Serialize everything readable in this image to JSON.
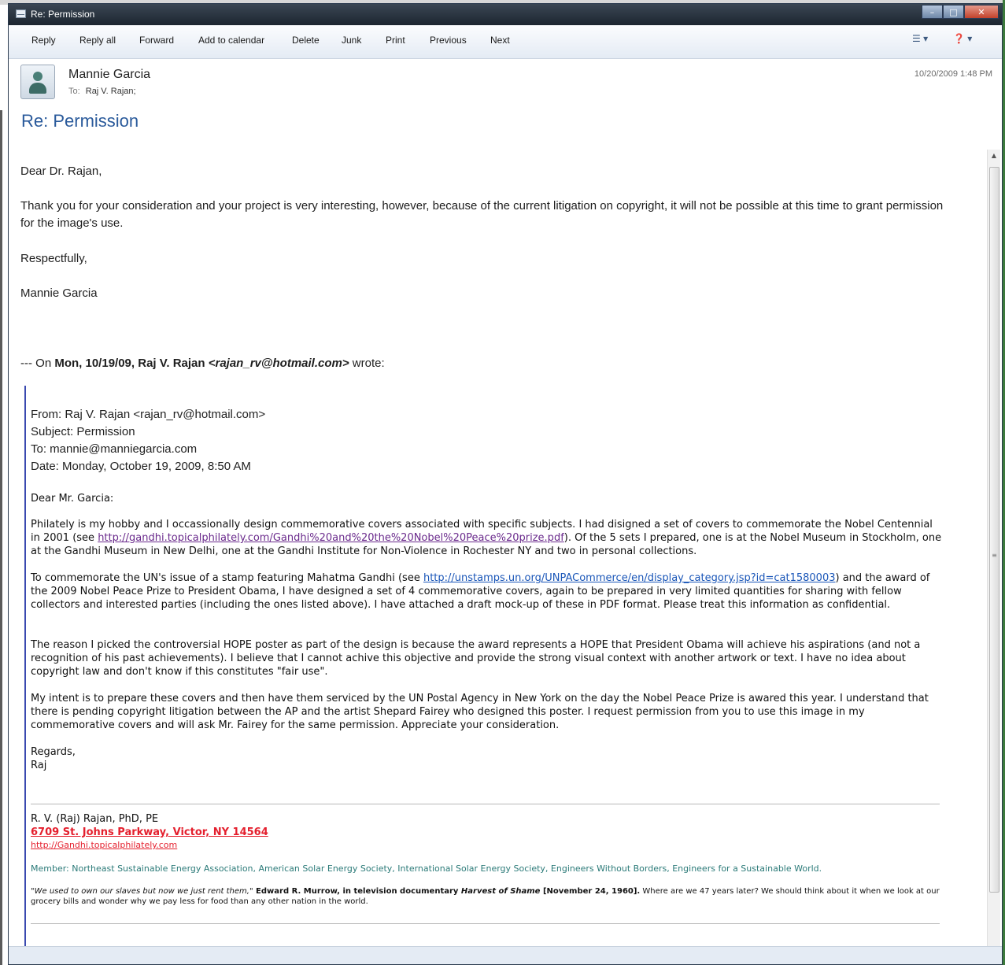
{
  "window": {
    "title": "Re: Permission"
  },
  "toolbar": {
    "buttons": [
      "Reply",
      "Reply all",
      "Forward",
      "Add to calendar",
      "Delete",
      "Junk",
      "Print",
      "Previous",
      "Next"
    ]
  },
  "header": {
    "sender_name": "Mannie Garcia",
    "to_label": "To:",
    "to_value": "Raj V. Rajan;",
    "timestamp": "10/20/2009 1:48 PM"
  },
  "subject": "Re: Permission",
  "reply": {
    "greeting": "Dear Dr. Rajan,",
    "body": "Thank you for your consideration and your project is very interesting, however, because of the current litigation on copyright, it will not be possible at this time to grant permission for the image's use.",
    "closing": "Respectfully,",
    "signature": "Mannie Garcia"
  },
  "quote_intro": {
    "prefix": "--- On",
    "date": "Mon, 10/19/09,",
    "sender": "Raj V. Rajan",
    "email": "<rajan_rv@hotmail.com>",
    "suffix": "wrote:"
  },
  "quoted": {
    "from": "From: Raj V. Rajan <rajan_rv@hotmail.com>",
    "subject": "Subject: Permission",
    "to": "To: mannie@manniegarcia.com",
    "date": "Date: Monday, October 19, 2009, 8:50 AM",
    "salutation": "Dear Mr. Garcia:",
    "p1_a": "Philately is my hobby and I occassionally design commemorative covers associated with specific subjects.  I had disigned a set of covers to commemorate the Nobel Centennial in 2001 (see ",
    "p1_link": "http://gandhi.topicalphilately.com/Gandhi%20and%20the%20Nobel%20Peace%20prize.pdf",
    "p1_b": ").  Of the 5 sets I prepared, one is at the Nobel Museum in Stockholm, one at the Gandhi Museum in New Delhi, one at the Gandhi Institute for Non-Violence in Rochester NY and two in personal collections.",
    "p2_a": "To commemorate the UN's issue of a stamp featuring Mahatma Gandhi (see ",
    "p2_link": "http://unstamps.un.org/UNPACommerce/en/display_category.jsp?id=cat1580003",
    "p2_b": ") and the award of the 2009 Nobel Peace Prize to President Obama, I have designed a set of 4 commemorative covers, again to be prepared in very limited quantities for sharing with fellow collectors and interested parties (including the ones listed above).  I have attached a draft mock-up of these in PDF format.  Please treat this information as confidential.",
    "p3": "The reason I picked the controversial HOPE poster as part of the design is because the award represents a HOPE that President Obama will achieve his aspirations (and not a recognition of his past achievements).  I believe that I cannot achive this objective and provide the strong visual context with another artwork or text.  I have no idea about copyright law and don't know if this constitutes \"fair use\".",
    "p4": "My intent is to prepare these covers and then have them serviced by the UN Postal Agency in New York on the day the Nobel Peace Prize is awared this year.  I understand that there is pending copyright litigation between the AP and the artist Shepard Fairey who designed this poster.  I request permission from you to use this image in my commemorative covers and will ask Mr. Fairey for the same permission.  Appreciate your consideration.",
    "regards": "Regards,",
    "name": "Raj"
  },
  "signature": {
    "name": "R. V. (Raj) Rajan, PhD, PE",
    "address": "6709 St. Johns Parkway, Victor, NY 14564",
    "url": "http://Gandhi.topicalphilately.com",
    "member": "Member: Northeast Sustainable Energy Association, American Solar Energy Society, International Solar Energy Society, Engineers Without Borders, Engineers for a Sustainable World.",
    "quote_italic": "\"We used to own our slaves but now we just rent them,\"",
    "quote_author": " Edward R. Murrow, in television documentary ",
    "quote_work": "Harvest of Shame",
    "quote_date": " [November 24, 1960].",
    "quote_rest": "  Where are we 47 years later? We should think about it when we look at our grocery bills and wonder why we pay less for food than any other nation in the world."
  },
  "colors": {
    "subject": "#2a5a9b",
    "quote_bar": "#3b4ab0",
    "address": "#e4202e",
    "member": "#2b7a78"
  }
}
